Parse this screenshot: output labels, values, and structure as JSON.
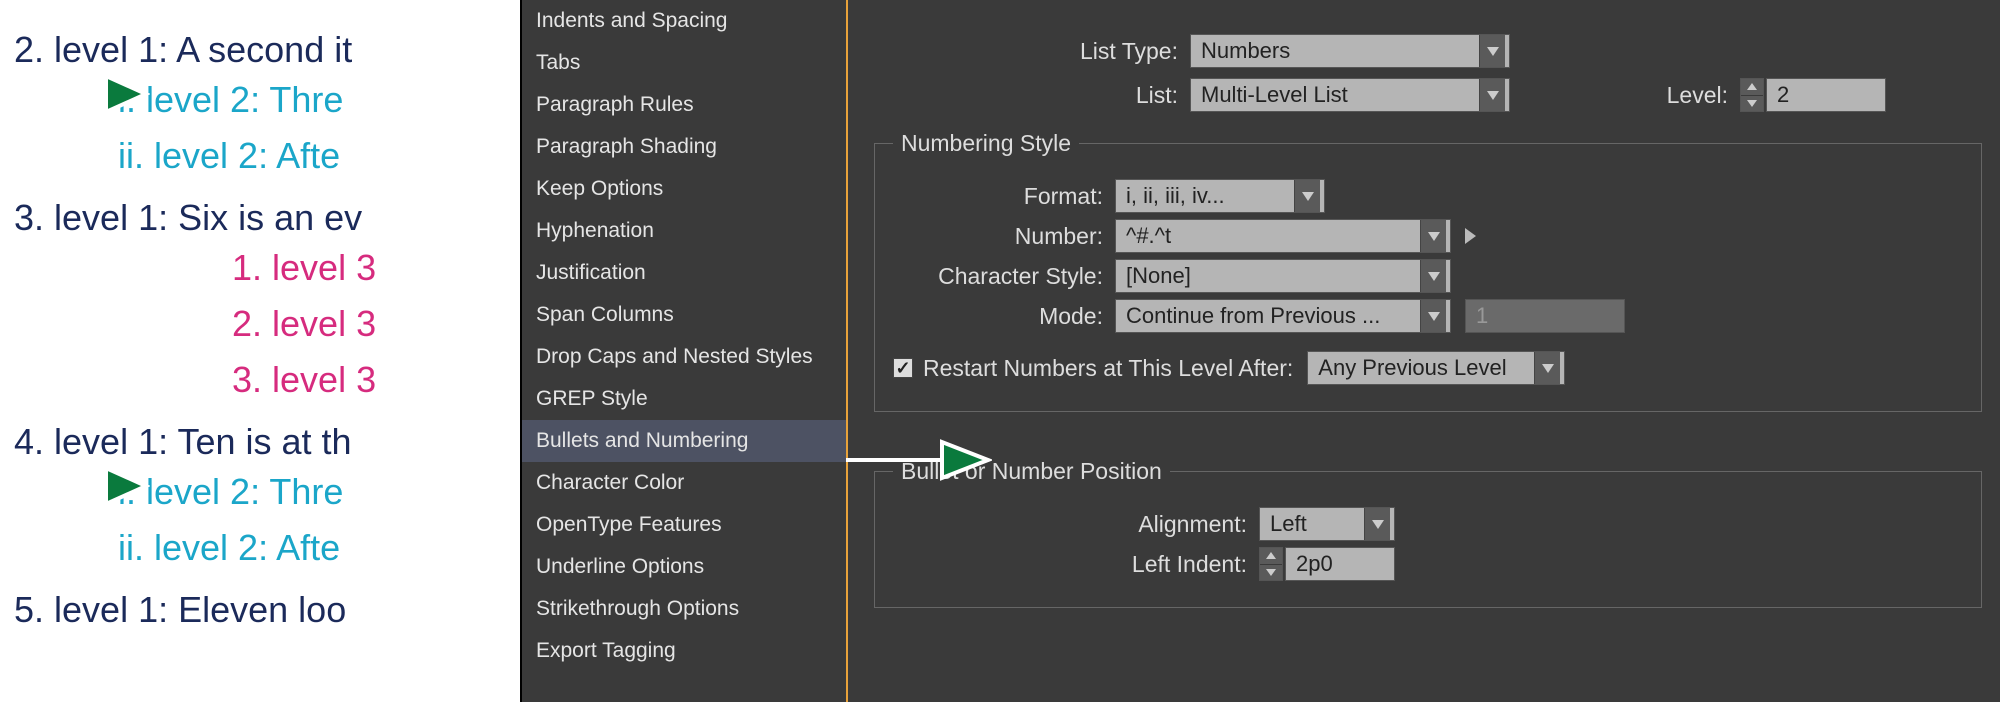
{
  "document": {
    "lines": [
      {
        "cls": "l1",
        "text": "2. level 1: A second it"
      },
      {
        "cls": "l2",
        "text": "i.  level 2: Thre"
      },
      {
        "cls": "l2",
        "text": "ii. level 2: Afte"
      },
      {
        "cls": "l1",
        "text": "3. level 1: Six is an ev"
      },
      {
        "cls": "l3",
        "text": "1.  level 3"
      },
      {
        "cls": "l3",
        "text": "2. level 3"
      },
      {
        "cls": "l3",
        "text": "3. level 3"
      },
      {
        "cls": "l1",
        "text": "4. level 1: Ten is at th"
      },
      {
        "cls": "l2",
        "text": "i.  level 2: Thre"
      },
      {
        "cls": "l2",
        "text": "ii. level 2: Afte"
      },
      {
        "cls": "l1",
        "text": "5. level 1: Eleven loo"
      }
    ],
    "arrow_rows": [
      1,
      8
    ]
  },
  "sidebar_items": [
    "Indents and Spacing",
    "Tabs",
    "Paragraph Rules",
    "Paragraph Shading",
    "Keep Options",
    "Hyphenation",
    "Justification",
    "Span Columns",
    "Drop Caps and Nested Styles",
    "GREP Style",
    "Bullets and Numbering",
    "Character Color",
    "OpenType Features",
    "Underline Options",
    "Strikethrough Options",
    "Export Tagging"
  ],
  "sidebar_selected_index": 10,
  "top": {
    "list_type_label": "List Type:",
    "list_type_value": "Numbers",
    "list_label": "List:",
    "list_value": "Multi-Level List",
    "level_label": "Level:",
    "level_value": "2"
  },
  "numbering": {
    "legend": "Numbering Style",
    "format_label": "Format:",
    "format_value": "i, ii, iii, iv...",
    "number_label": "Number:",
    "number_value": "^#.^t",
    "charstyle_label": "Character Style:",
    "charstyle_value": "[None]",
    "mode_label": "Mode:",
    "mode_value": "Continue from Previous ...",
    "mode_startat": "1",
    "restart_label": "Restart Numbers at This Level After:",
    "restart_value": "Any Previous Level",
    "restart_checked": true
  },
  "position": {
    "legend": "Bullet or Number Position",
    "alignment_label": "Alignment:",
    "alignment_value": "Left",
    "leftindent_label": "Left Indent:",
    "leftindent_value": "2p0"
  }
}
